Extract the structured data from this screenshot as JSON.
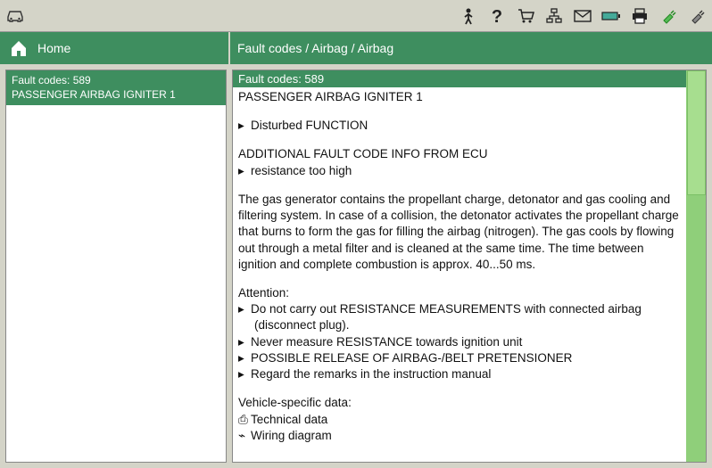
{
  "nav": {
    "home": "Home",
    "breadcrumb": "Fault codes / Airbag / Airbag"
  },
  "sidebar": {
    "line1": "Fault codes: 589",
    "line2": "PASSENGER AIRBAG IGNITER 1"
  },
  "content": {
    "header": "Fault codes: 589",
    "title": "PASSENGER AIRBAG IGNITER 1",
    "fn1": "Disturbed FUNCTION",
    "ecu_header": "ADDITIONAL FAULT CODE INFO FROM ECU",
    "ecu1": "resistance too high",
    "desc": "The gas generator contains the propellant charge, detonator and gas cooling and filtering system. In case of a collision, the detonator activates the propellant charge that burns to form the gas for filling the airbag (nitrogen). The gas cools by flowing out through a metal filter and is cleaned at the same time. The time between ignition and complete combustion is approx. 40...50 ms.",
    "attention_label": "Attention:",
    "att1a": "Do not carry out RESISTANCE MEASUREMENTS with connected airbag",
    "att1b": "(disconnect plug).",
    "att2": "Never measure RESISTANCE towards ignition unit",
    "att3": "POSSIBLE RELEASE OF AIRBAG-/BELT PRETENSIONER",
    "att4": "Regard the remarks in the instruction manual",
    "vsd_label": "Vehicle-specific data:",
    "vsd1": "Technical data",
    "vsd2": "Wiring diagram"
  }
}
